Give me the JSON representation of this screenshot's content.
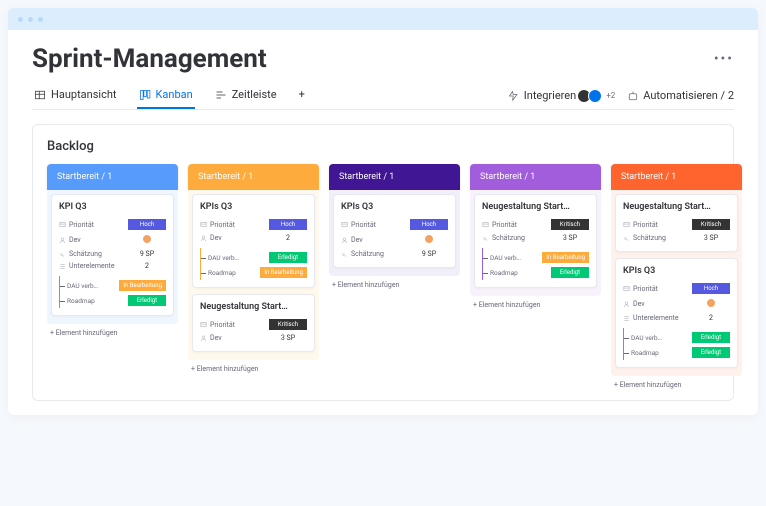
{
  "title": "Sprint-Management",
  "more": "•••",
  "tabs": {
    "main": "Hauptansicht",
    "kanban": "Kanban",
    "timeline": "Zeitleiste",
    "plus": "+"
  },
  "actions": {
    "integrate": "Integrieren",
    "intCount": "+2",
    "automate": "Automatisieren / 2"
  },
  "board": {
    "title": "Backlog",
    "add": "+ Element hinzufügen"
  },
  "labels": {
    "prio": "Priorität",
    "dev": "Dev",
    "est": "Schätzung",
    "subs": "Unterelemente"
  },
  "badges": {
    "hoch": "Hoch",
    "krit": "Kritisch",
    "done": "Erledigt",
    "prog": "In Bearbeitung"
  },
  "cols": [
    {
      "head": "Startbereit / 1",
      "color": "blue",
      "cards": [
        {
          "title": "KPI Q3",
          "prio": "hoch",
          "dev": "av",
          "est": "9 SP",
          "subs": "2",
          "subsItems": [
            {
              "t": "DAU verb…",
              "b": "prog"
            },
            {
              "t": "Roadmap",
              "b": "done"
            }
          ]
        }
      ]
    },
    {
      "head": "Startbereit / 1",
      "color": "yellow",
      "cards": [
        {
          "title": "KPIs Q3",
          "prio": "hoch",
          "dev": "2",
          "subsItems": [
            {
              "t": "DAU verb…",
              "b": "done"
            },
            {
              "t": "Roadmap",
              "b": "prog"
            }
          ]
        },
        {
          "title": "Neugestaltung Start…",
          "prio": "krit",
          "dev": "3 SP"
        }
      ]
    },
    {
      "head": "Startbereit / 1",
      "color": "indigo",
      "cards": [
        {
          "title": "KPIs Q3",
          "prio": "hoch",
          "dev": "av",
          "est": "9 SP"
        }
      ]
    },
    {
      "head": "Startbereit / 1",
      "color": "purple",
      "cards": [
        {
          "title": "Neugestaltung Start…",
          "prio": "krit",
          "est": "3 SP",
          "subsItems": [
            {
              "t": "DAU verb…",
              "b": "prog"
            },
            {
              "t": "Roadmap",
              "b": "done"
            }
          ]
        }
      ]
    },
    {
      "head": "Startbereit / 1",
      "color": "orange",
      "cards": [
        {
          "title": "Neugestaltung Start…",
          "prio": "krit",
          "est": "3 SP"
        },
        {
          "title": "KPIs Q3",
          "prio": "hoch",
          "dev": "av",
          "subs": "2",
          "subsItems": [
            {
              "t": "DAU verb…",
              "b": "done"
            },
            {
              "t": "Roadmap",
              "b": "done"
            }
          ]
        }
      ]
    }
  ]
}
